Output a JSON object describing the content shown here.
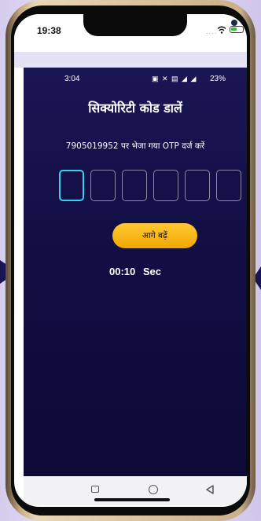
{
  "phone_status": {
    "time": "19:38"
  },
  "app_status": {
    "time": "3:04",
    "battery": "23%"
  },
  "otp_screen": {
    "title": "सिक्योरिटी कोड डालें",
    "subtitle": "7905019952 पर भेजा गया OTP दर्ज करें",
    "otp_digits": [
      "",
      "",
      "",
      "",
      "",
      ""
    ],
    "cta_label": "आगे बढ़ें",
    "timer_text": "00:10  Sec"
  },
  "colors": {
    "app_background": "#120f45",
    "accent_button": "#fbb917",
    "active_box_border": "#3bd0ee"
  },
  "icons": [
    "wifi-icon",
    "battery-icon",
    "nav-recents-icon",
    "nav-home-icon",
    "nav-back-icon"
  ]
}
